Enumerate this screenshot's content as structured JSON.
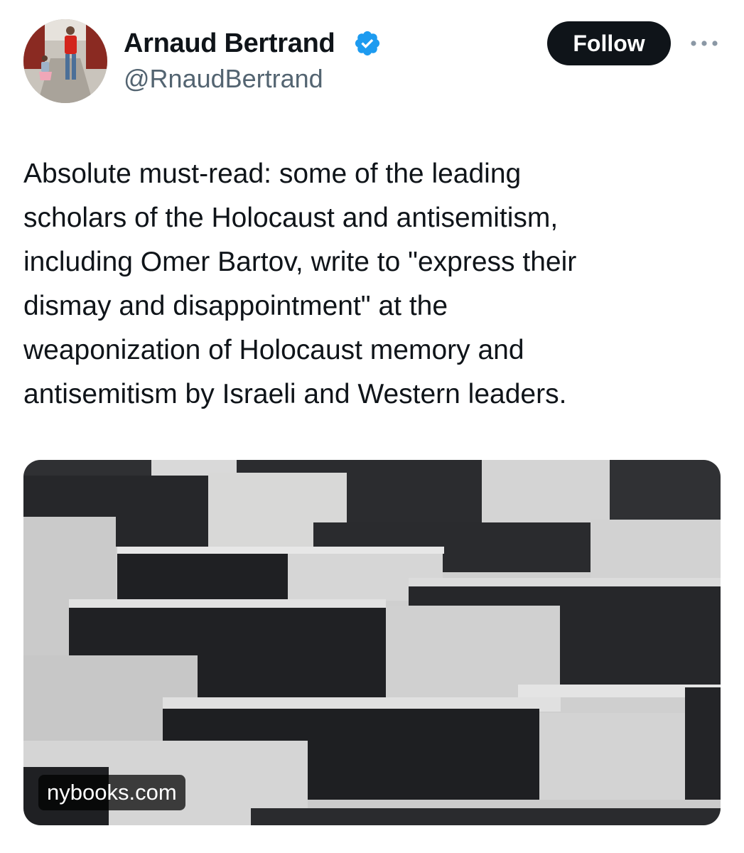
{
  "author": {
    "display_name": "Arnaud Bertrand",
    "handle": "@RnaudBertrand",
    "verified": true
  },
  "actions": {
    "follow_label": "Follow"
  },
  "tweet": {
    "text_lines": [
      "Absolute must-read: some of the leading",
      "scholars of the Holocaust and antisemitism,",
      "including Omer Bartov, write to \"express their",
      "dismay and disappointment\" at the",
      "weaponization of Holocaust memory and",
      "antisemitism by Israeli and Western leaders."
    ]
  },
  "media": {
    "source_domain": "nybooks.com"
  },
  "colors": {
    "text_primary": "#0f1419",
    "text_secondary": "#536471",
    "verified_blue": "#1d9bf0",
    "follow_bg": "#0f1419",
    "follow_text": "#ffffff"
  },
  "icons": {
    "verified": "verified-badge-icon",
    "more": "more-horizontal-icon"
  }
}
